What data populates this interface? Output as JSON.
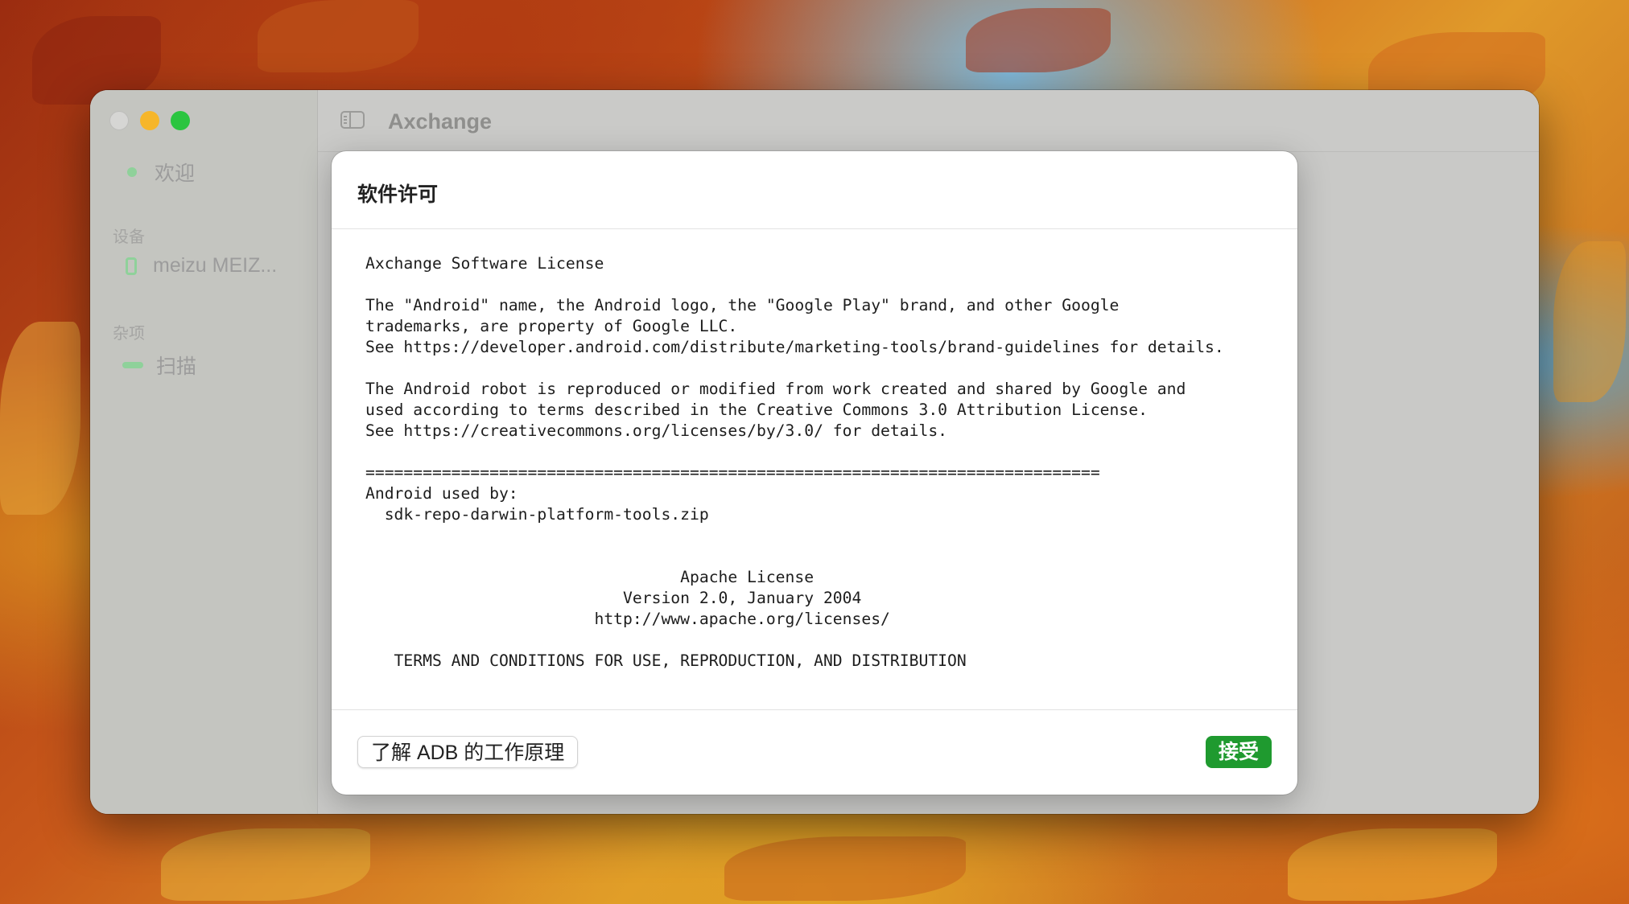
{
  "window": {
    "app_title": "Axchange"
  },
  "sidebar": {
    "items": [
      {
        "label": "欢迎",
        "icon": "dot-icon"
      },
      {
        "section": "设备"
      },
      {
        "label": "meizu MEIZ...",
        "icon": "phone-icon"
      },
      {
        "section": "杂项"
      },
      {
        "label": "扫描",
        "icon": "scan-icon"
      }
    ]
  },
  "dialog": {
    "title": "软件许可",
    "license_text": "Axchange Software License\n\nThe \"Android\" name, the Android logo, the \"Google Play\" brand, and other Google\ntrademarks, are property of Google LLC.\nSee https://developer.android.com/distribute/marketing-tools/brand-guidelines for details.\n\nThe Android robot is reproduced or modified from work created and shared by Google and\nused according to terms described in the Creative Commons 3.0 Attribution License.\nSee https://creativecommons.org/licenses/by/3.0/ for details.\n\n=============================================================================\nAndroid used by:\n  sdk-repo-darwin-platform-tools.zip\n\n\n                                 Apache License\n                           Version 2.0, January 2004\n                        http://www.apache.org/licenses/\n\n   TERMS AND CONDITIONS FOR USE, REPRODUCTION, AND DISTRIBUTION",
    "learn_button": "了解 ADB 的工作原理",
    "accept_button": "接受"
  },
  "colors": {
    "accept": "#1f9a2f",
    "traffic_close": "#d6d6d4",
    "traffic_minimize": "#f6b62a",
    "traffic_maximize": "#2bc540",
    "sidebar_icon": "#8fd19a"
  }
}
